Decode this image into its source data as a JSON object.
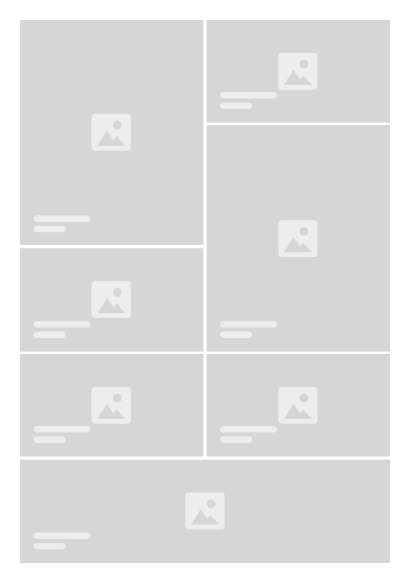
{
  "app": {
    "layout": "masonry-grid",
    "state": "loading-skeleton"
  },
  "colors": {
    "background": "#ffffff",
    "tile": "#d6d6d6",
    "placeholder": "#ededed"
  },
  "tiles": [
    {
      "id": "tile-1",
      "icon": "image-placeholder-icon",
      "caption_lines": 2
    },
    {
      "id": "tile-2",
      "icon": "image-placeholder-icon",
      "caption_lines": 2
    },
    {
      "id": "tile-3",
      "icon": "image-placeholder-icon",
      "caption_lines": 2
    },
    {
      "id": "tile-4",
      "icon": "image-placeholder-icon",
      "caption_lines": 2
    },
    {
      "id": "tile-5",
      "icon": "image-placeholder-icon",
      "caption_lines": 2
    },
    {
      "id": "tile-6",
      "icon": "image-placeholder-icon",
      "caption_lines": 2
    },
    {
      "id": "tile-7",
      "icon": "image-placeholder-icon",
      "caption_lines": 2
    }
  ]
}
